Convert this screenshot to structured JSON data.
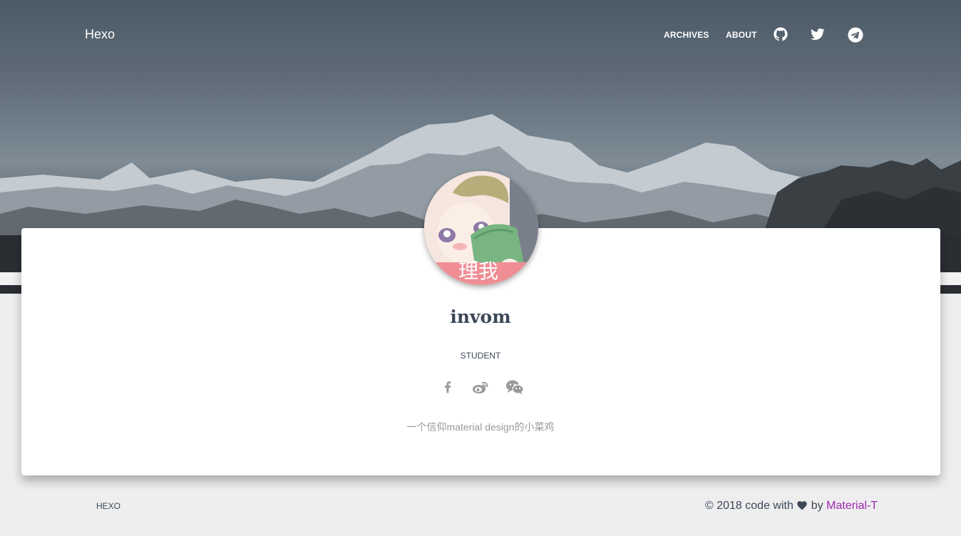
{
  "nav": {
    "brand": "Hexo",
    "links": [
      {
        "label": "ARCHIVES"
      },
      {
        "label": "ABOUT"
      }
    ],
    "icons": [
      "github-icon",
      "twitter-icon",
      "telegram-icon"
    ]
  },
  "profile": {
    "avatar_caption": "理我",
    "name": "invom",
    "role": "STUDENT",
    "social_icons": [
      "facebook-icon",
      "weibo-icon",
      "wechat-icon"
    ],
    "bio": "一个信仰material design的小菜鸡"
  },
  "footer": {
    "left": "HEXO",
    "copyright": "© 2018 code with",
    "by": "by",
    "link": "Material-T"
  },
  "colors": {
    "text": "#3c4858",
    "accent": "#9c27b0",
    "muted": "#999999",
    "background": "#eeeeee"
  }
}
